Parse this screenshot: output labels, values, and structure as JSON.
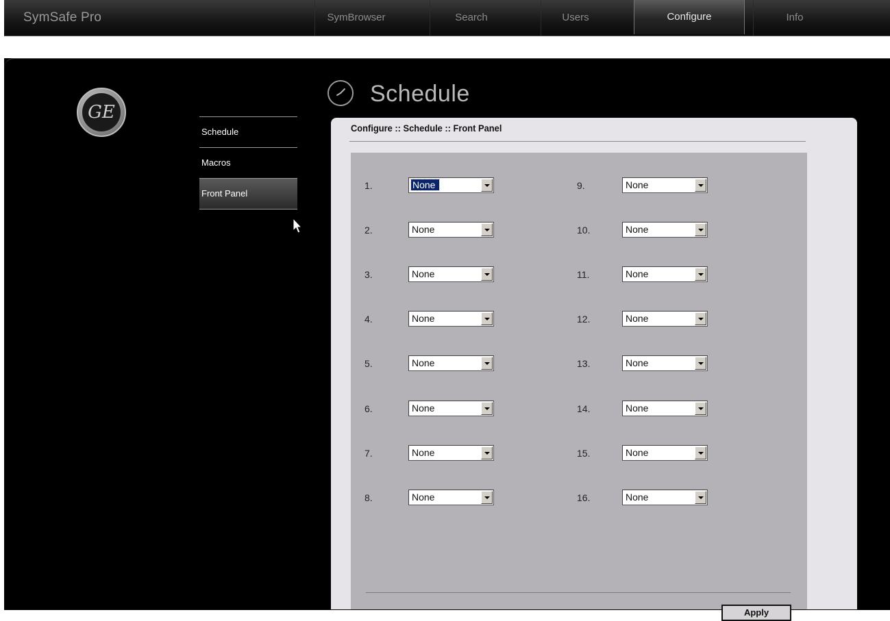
{
  "app": {
    "title": "SymSafe Pro"
  },
  "nav": {
    "tabs": [
      {
        "label": "SymBrowser",
        "active": false
      },
      {
        "label": "Search",
        "active": false
      },
      {
        "label": "Users",
        "active": false
      },
      {
        "label": "Configure",
        "active": true
      },
      {
        "label": "Info",
        "active": false
      }
    ]
  },
  "logo": {
    "text": "GE"
  },
  "sidebar": {
    "items": [
      {
        "label": "Schedule",
        "active": false
      },
      {
        "label": "Macros",
        "active": false
      },
      {
        "label": "Front Panel",
        "active": true
      }
    ]
  },
  "page": {
    "title": "Schedule",
    "icon": "clock-icon",
    "breadcrumb": "Configure :: Schedule :: Front Panel"
  },
  "slots": [
    {
      "label": "1.",
      "value": "None",
      "selected": true
    },
    {
      "label": "2.",
      "value": "None"
    },
    {
      "label": "3.",
      "value": "None"
    },
    {
      "label": "4.",
      "value": "None"
    },
    {
      "label": "5.",
      "value": "None"
    },
    {
      "label": "6.",
      "value": "None"
    },
    {
      "label": "7.",
      "value": "None"
    },
    {
      "label": "8.",
      "value": "None"
    },
    {
      "label": "9.",
      "value": "None"
    },
    {
      "label": "10.",
      "value": "None"
    },
    {
      "label": "11.",
      "value": "None"
    },
    {
      "label": "12.",
      "value": "None"
    },
    {
      "label": "13.",
      "value": "None"
    },
    {
      "label": "14.",
      "value": "None"
    },
    {
      "label": "15.",
      "value": "None"
    },
    {
      "label": "16.",
      "value": "None"
    }
  ],
  "actions": {
    "apply_label": "Apply"
  }
}
